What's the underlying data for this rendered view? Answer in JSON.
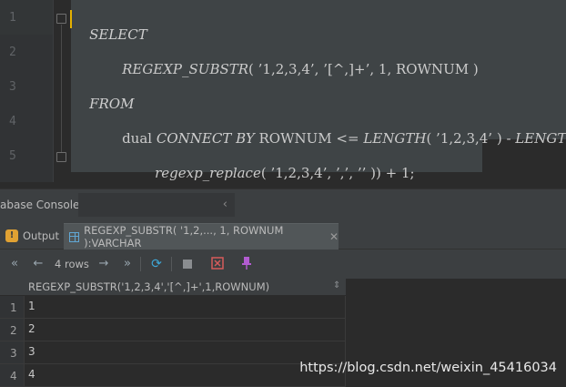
{
  "editor": {
    "line_numbers": [
      "1",
      "2",
      "3",
      "4",
      "5"
    ],
    "lines": [
      {
        "kw": "SELECT"
      },
      {
        "fn": "REGEXP_SUBSTR",
        "args": "( ’1,2,3,4’, ’[^,]+’, 1, ROWNUM )"
      },
      {
        "kw": "FROM"
      },
      {
        "pre": "dual ",
        "kw": "CONNECT BY",
        "mid": " ROWNUM <= ",
        "fn": "LENGTH",
        "args": "( ’1,2,3,4’ ) - ",
        "fn2": "LENGTH("
      },
      {
        "fn": "regexp_replace",
        "args": "( ’1,2,3,4’, ’,’, ’’ )) + 1;"
      }
    ]
  },
  "console": {
    "label": "abase Console:",
    "chevron": "‹"
  },
  "tabs": [
    {
      "label": "Output",
      "icon": "output-icon"
    },
    {
      "label": "REGEXP_SUBSTR( '1,2,..., 1, ROWNUM ):VARCHAR",
      "icon": "table-icon",
      "close": "✕"
    }
  ],
  "toolbar": {
    "first": "«",
    "prev": "←",
    "row_count": "4 rows",
    "next": "→",
    "last": "»",
    "reload": "⟳",
    "pin": "📌"
  },
  "grid": {
    "column_header": "REGEXP_SUBSTR('1,2,3,4','[^,]+',1,ROWNUM)",
    "sort_icon": "⇕",
    "rows": [
      {
        "num": "1",
        "value": "1"
      },
      {
        "num": "2",
        "value": "2"
      },
      {
        "num": "3",
        "value": "3"
      },
      {
        "num": "4",
        "value": "4"
      }
    ]
  },
  "watermark": "https://blog.csdn.net/weixin_45416034",
  "colors": {
    "background": "#2b2b2b",
    "caret": "#e5b100",
    "reload_icon": "#3ea8d8",
    "pin_icon": "#b35cd1",
    "output_icon": "#e0a133"
  }
}
